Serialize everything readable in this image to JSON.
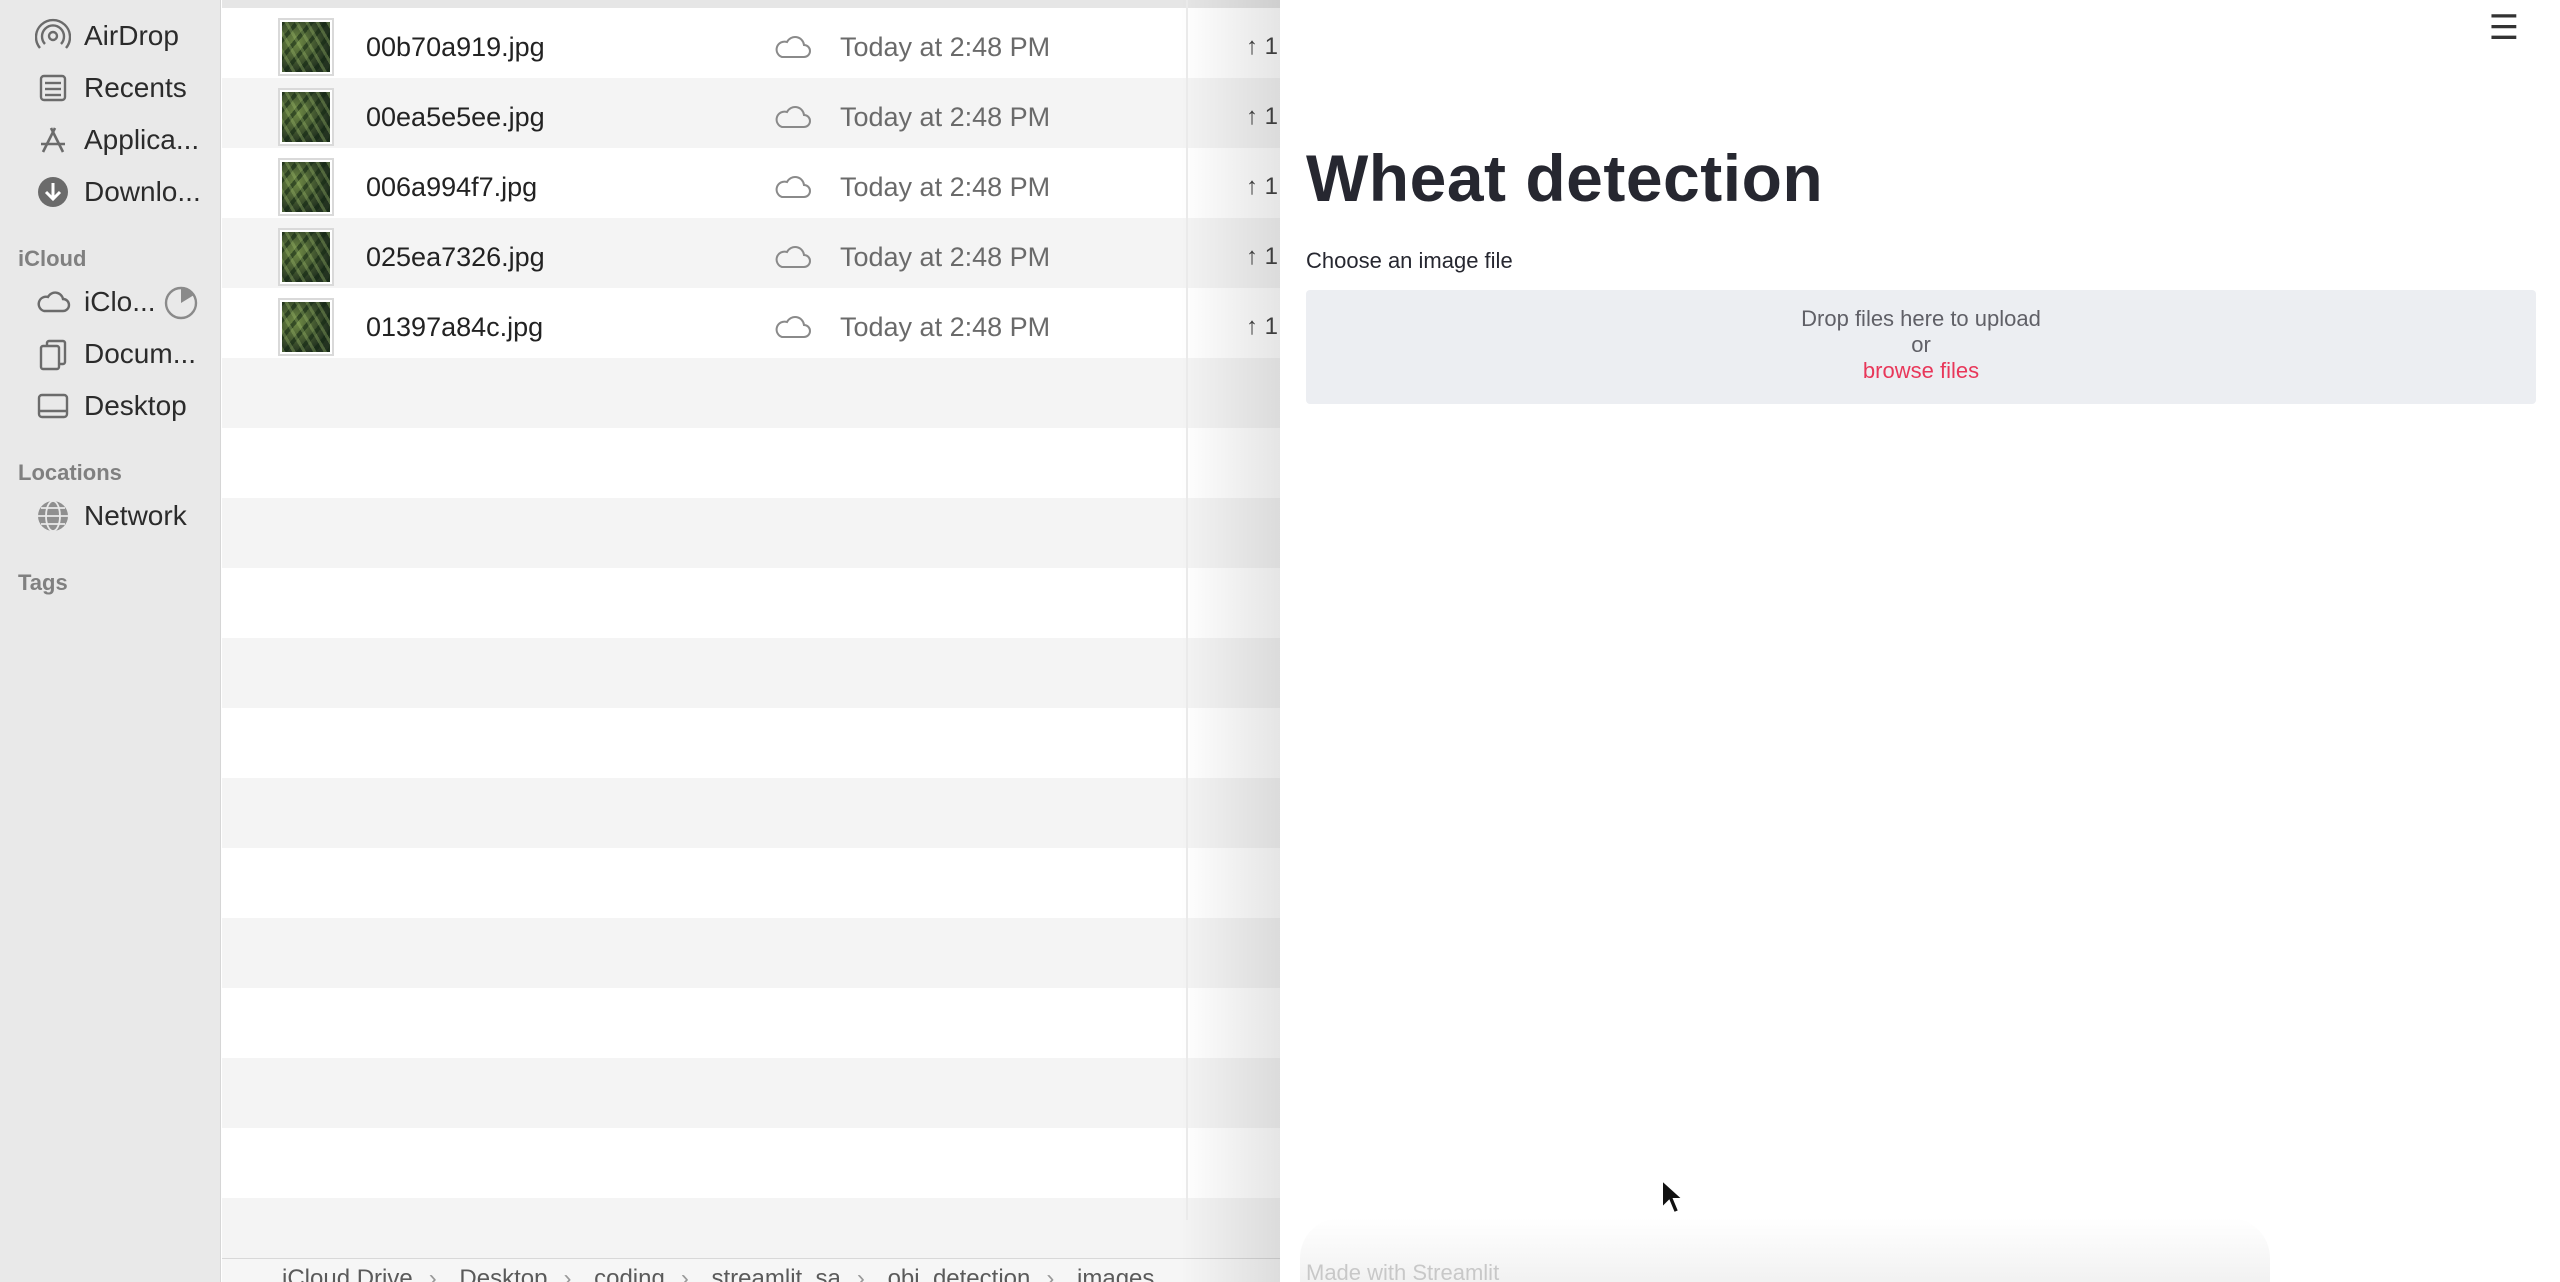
{
  "sidebar": {
    "items": [
      {
        "label": "AirDrop",
        "icon": "airdrop-icon"
      },
      {
        "label": "Recents",
        "icon": "clock-icon"
      },
      {
        "label": "Applica...",
        "icon": "applications-icon"
      },
      {
        "label": "Downlo...",
        "icon": "download-icon"
      }
    ],
    "icloud_heading": "iCloud",
    "icloud_items": [
      {
        "label": "iClo...",
        "icon": "cloud-icon"
      },
      {
        "label": "Docum...",
        "icon": "documents-icon"
      },
      {
        "label": "Desktop",
        "icon": "desktop-icon"
      }
    ],
    "locations_heading": "Locations",
    "location_items": [
      {
        "label": "Network",
        "icon": "network-icon"
      }
    ],
    "tags_heading": "Tags"
  },
  "files": [
    {
      "name": "00b70a919.jpg",
      "date": "Today at 2:48 PM",
      "size_prefix": "↑ 1"
    },
    {
      "name": "00ea5e5ee.jpg",
      "date": "Today at 2:48 PM",
      "size_prefix": "↑ 1"
    },
    {
      "name": "006a994f7.jpg",
      "date": "Today at 2:48 PM",
      "size_prefix": "↑ 1"
    },
    {
      "name": "025ea7326.jpg",
      "date": "Today at 2:48 PM",
      "size_prefix": "↑ 1"
    },
    {
      "name": "01397a84c.jpg",
      "date": "Today at 2:48 PM",
      "size_prefix": "↑ 1"
    }
  ],
  "pathbar": [
    "iCloud Drive",
    "Desktop",
    "coding",
    "streamlit_sa",
    "obj_detection",
    "images"
  ],
  "app": {
    "menu_icon": "☰",
    "title": "Wheat detection",
    "upload_label": "Choose an image file",
    "drop_text": "Drop files here to upload",
    "or_text": "or",
    "browse_text": "browse files",
    "footer": "Made with Streamlit",
    "accent_color": "#e8375a"
  }
}
